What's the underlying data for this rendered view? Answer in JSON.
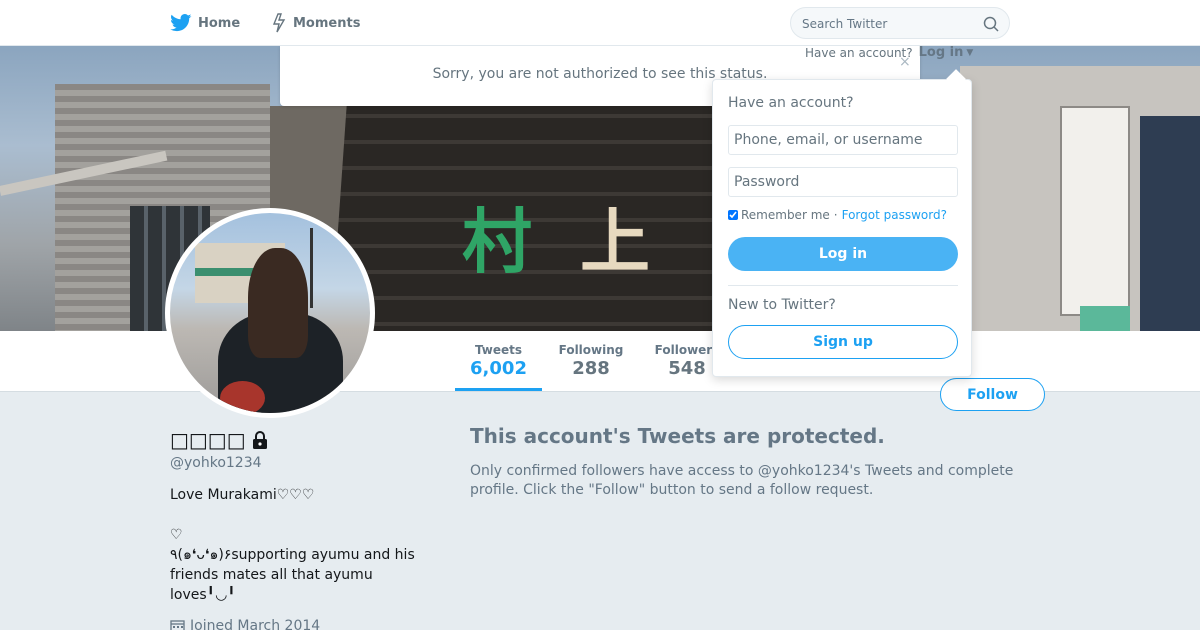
{
  "nav": {
    "home_label": "Home",
    "moments_label": "Moments",
    "search_placeholder": "Search Twitter",
    "home_icon": "bird-icon",
    "moments_icon": "lightning-icon",
    "search_icon": "search-icon"
  },
  "status_popup": {
    "message": "Sorry, you are not authorized to see this status.",
    "close": "×"
  },
  "login_bar": {
    "prompt": "Have an account?",
    "link": "Log in"
  },
  "login_dropdown": {
    "title": "Have an account?",
    "username_placeholder": "Phone, email, or username",
    "password_placeholder": "Password",
    "remember_label": "Remember me",
    "separator": "·",
    "forgot_label": "Forgot password?",
    "login_button": "Log in",
    "new_label": "New to Twitter?",
    "signup_button": "Sign up"
  },
  "banner": {
    "sign_chars": [
      "村",
      "上"
    ]
  },
  "stats": {
    "tweets_label": "Tweets",
    "tweets_value": "6,002",
    "following_label": "Following",
    "following_value": "288",
    "followers_label": "Followers",
    "followers_value": "548"
  },
  "follow_button": "Follow",
  "profile": {
    "fullname": "□□□□",
    "handle": "@yohko1234",
    "bio": "Love Murakami♡♡♡\n\n ♡\n٩(๑❛ᴗ❛๑)۶supporting ayumu and his friends mates all that ayumu loves╹◡╹",
    "joined": "Joined March 2014",
    "lock_icon": "lock-icon",
    "calendar_icon": "calendar-icon"
  },
  "protected": {
    "title": "This account's Tweets are protected.",
    "text": "Only confirmed followers have access to @yohko1234's Tweets and complete profile. Click the \"Follow\" button to send a follow request."
  },
  "colors": {
    "accent": "#1da1f2",
    "background": "#e6ecf0",
    "muted_text": "#657786"
  }
}
